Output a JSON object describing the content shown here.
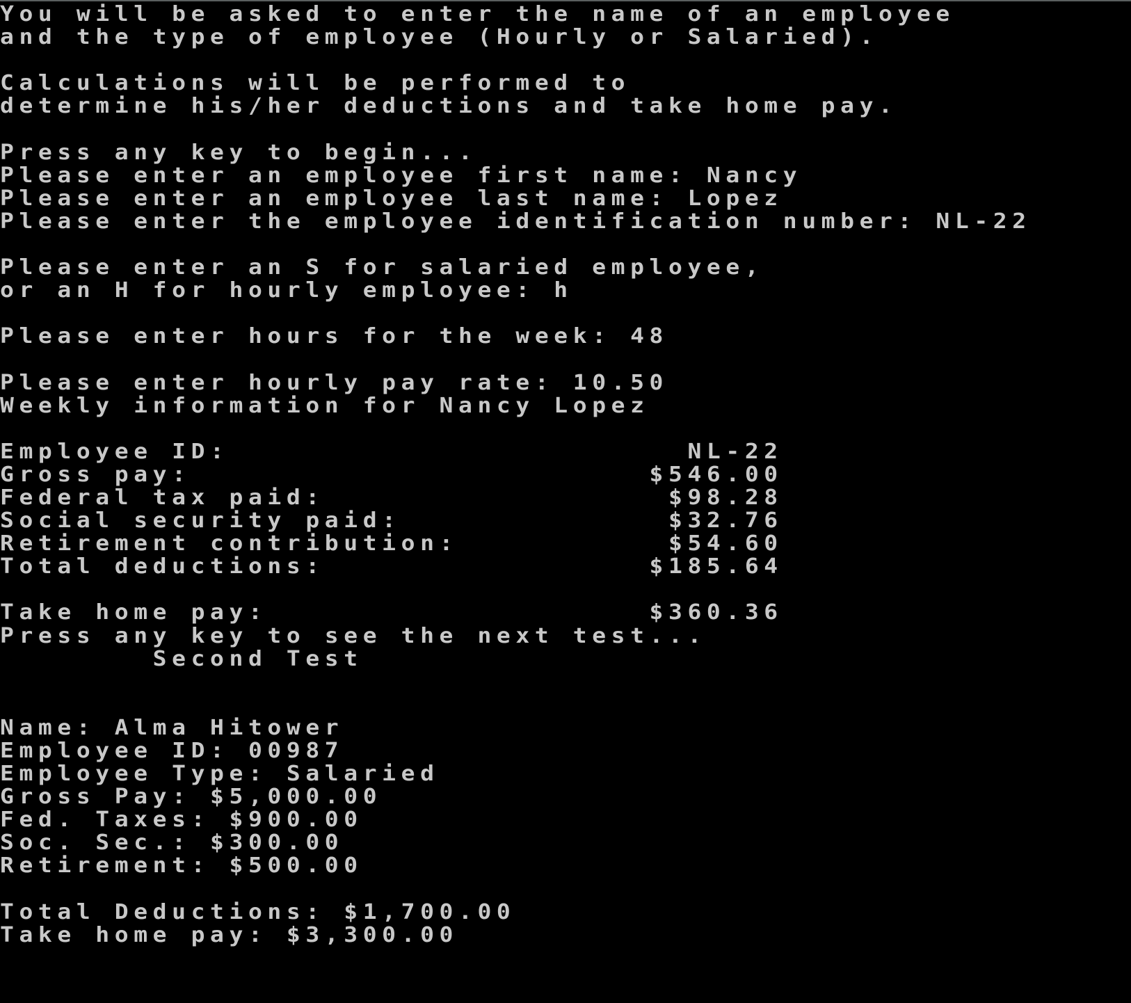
{
  "window": {
    "type": "console",
    "background": "#000000",
    "foreground": "#c8c8c8"
  },
  "console": {
    "lines": [
      {
        "text": "You will be asked to enter the name of an employee",
        "kind": "output"
      },
      {
        "text": "and the type of employee (Hourly or Salaried).",
        "kind": "output"
      },
      {
        "text": "",
        "kind": "blank"
      },
      {
        "text": "Calculations will be performed to",
        "kind": "output"
      },
      {
        "text": "determine his/her deductions and take home pay.",
        "kind": "output"
      },
      {
        "text": "",
        "kind": "blank"
      },
      {
        "text": "Press any key to begin...",
        "kind": "prompt"
      },
      {
        "text": "Please enter an employee first name: Nancy",
        "kind": "prompt"
      },
      {
        "text": "Please enter an employee last name: Lopez",
        "kind": "prompt"
      },
      {
        "text": "Please enter the employee identification number: NL-22",
        "kind": "prompt"
      },
      {
        "text": "",
        "kind": "blank"
      },
      {
        "text": "Please enter an S for salaried employee,",
        "kind": "prompt"
      },
      {
        "text": "or an H for hourly employee: h",
        "kind": "prompt"
      },
      {
        "text": "",
        "kind": "blank"
      },
      {
        "text": "Please enter hours for the week: 48",
        "kind": "prompt"
      },
      {
        "text": "",
        "kind": "blank"
      },
      {
        "text": "Please enter hourly pay rate: 10.50",
        "kind": "prompt"
      },
      {
        "text": "Weekly information for Nancy Lopez",
        "kind": "output"
      },
      {
        "text": "",
        "kind": "blank"
      },
      {
        "text": "Employee ID:                        NL-22",
        "kind": "report"
      },
      {
        "text": "Gross pay:                        $546.00",
        "kind": "report"
      },
      {
        "text": "Federal tax paid:                  $98.28",
        "kind": "report"
      },
      {
        "text": "Social security paid:              $32.76",
        "kind": "report"
      },
      {
        "text": "Retirement contribution:           $54.60",
        "kind": "report"
      },
      {
        "text": "Total deductions:                 $185.64",
        "kind": "report"
      },
      {
        "text": "",
        "kind": "blank"
      },
      {
        "text": "Take home pay:                    $360.36",
        "kind": "report"
      },
      {
        "text": "Press any key to see the next test...",
        "kind": "prompt"
      },
      {
        "text": "        Second Test",
        "kind": "heading"
      },
      {
        "text": "",
        "kind": "blank"
      },
      {
        "text": "",
        "kind": "blank"
      },
      {
        "text": "Name: Alma Hitower",
        "kind": "report"
      },
      {
        "text": "Employee ID: 00987",
        "kind": "report"
      },
      {
        "text": "Employee Type: Salaried",
        "kind": "report"
      },
      {
        "text": "Gross Pay: $5,000.00",
        "kind": "report"
      },
      {
        "text": "Fed. Taxes: $900.00",
        "kind": "report"
      },
      {
        "text": "Soc. Sec.: $300.00",
        "kind": "report"
      },
      {
        "text": "Retirement: $500.00",
        "kind": "report"
      },
      {
        "text": "",
        "kind": "blank"
      },
      {
        "text": "Total Deductions: $1,700.00",
        "kind": "report"
      },
      {
        "text": "Take home pay: $3,300.00",
        "kind": "report"
      }
    ]
  },
  "first_test": {
    "intro": [
      "You will be asked to enter the name of an employee",
      "and the type of employee (Hourly or Salaried).",
      "Calculations will be performed to",
      "determine his/her deductions and take home pay."
    ],
    "inputs": {
      "first_name": "Nancy",
      "last_name": "Lopez",
      "employee_id": "NL-22",
      "employee_type": "h",
      "hours": "48",
      "hourly_rate": "10.50"
    },
    "report": {
      "employee_id": "NL-22",
      "gross_pay": "$546.00",
      "federal_tax": "$98.28",
      "social_security": "$32.76",
      "retirement": "$54.60",
      "total_deductions": "$185.64",
      "take_home_pay": "$360.36"
    }
  },
  "second_test": {
    "heading": "Second Test",
    "name": "Alma Hitower",
    "employee_id": "00987",
    "employee_type": "Salaried",
    "gross_pay": "$5,000.00",
    "fed_taxes": "$900.00",
    "soc_sec": "$300.00",
    "retirement": "$500.00",
    "total_deductions": "$1,700.00",
    "take_home_pay": "$3,300.00"
  }
}
